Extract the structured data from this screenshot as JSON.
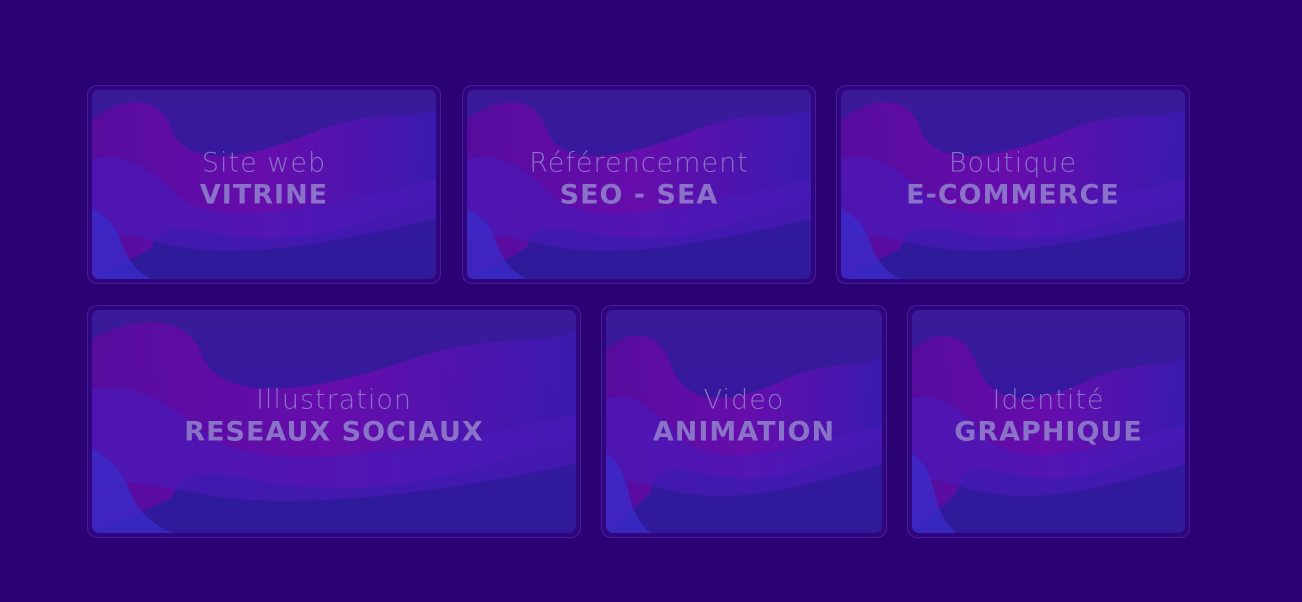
{
  "colors": {
    "background": "#2b0274",
    "card_border": "#5a2fb0",
    "label_text": "#8a72c8",
    "wave_magenta": "#6a0aa8",
    "wave_blue": "#2e2ac0"
  },
  "services": [
    {
      "line1": "Site web",
      "line2": "VITRINE"
    },
    {
      "line1": "Référencement",
      "line2": "SEO - SEA"
    },
    {
      "line1": "Boutique",
      "line2": "E-COMMERCE"
    },
    {
      "line1": "Illustration",
      "line2": "RESEAUX SOCIAUX"
    },
    {
      "line1": "Video",
      "line2": "ANIMATION"
    },
    {
      "line1": "Identité",
      "line2": "GRAPHIQUE"
    }
  ]
}
